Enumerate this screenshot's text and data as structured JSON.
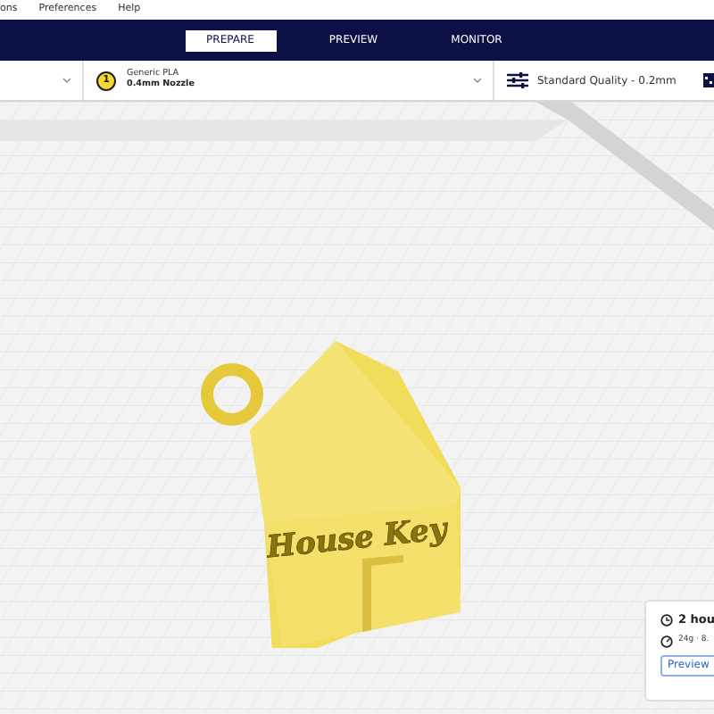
{
  "menu": [
    "ons",
    "Preferences",
    "Help"
  ],
  "tabs": [
    {
      "label": "PREPARE",
      "selected": true
    },
    {
      "label": "PREVIEW",
      "selected": false
    },
    {
      "label": "MONITOR",
      "selected": false
    }
  ],
  "material": {
    "extruder": "1",
    "name": "Generic PLA",
    "nozzle": "0.4mm Nozzle"
  },
  "profile": "Standard Quality - 0.2mm",
  "model": {
    "label": "House Key"
  },
  "estimate": {
    "time": "2 hou",
    "usage": "24g · 8.",
    "button": "Preview"
  }
}
